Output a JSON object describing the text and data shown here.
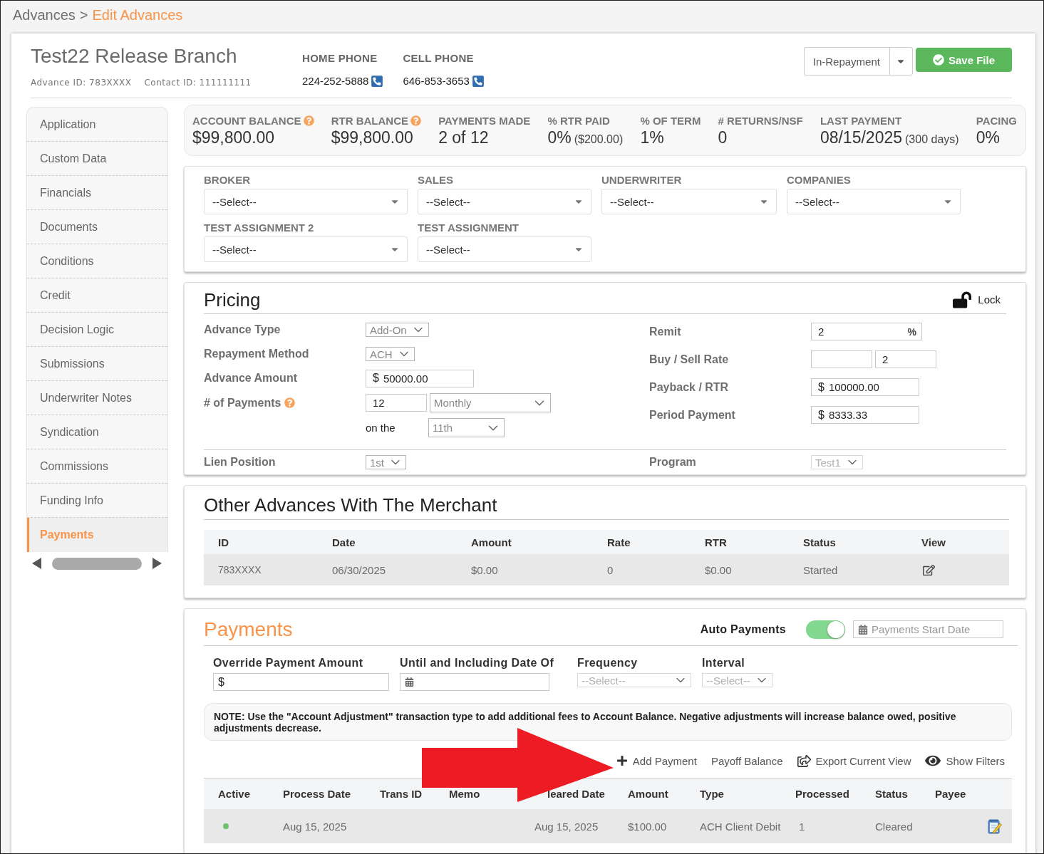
{
  "breadcrumb": {
    "parent": "Advances",
    "separator": ">",
    "current": "Edit Advances"
  },
  "header": {
    "title": "Test22 Release Branch",
    "ids": [
      "Advance ID: 783XXXX",
      "Contact ID: 111111111"
    ],
    "phones": [
      {
        "label": "HOME PHONE",
        "number": "224-252-5888"
      },
      {
        "label": "CELL PHONE",
        "number": "646-853-3653"
      }
    ],
    "status": "In-Repayment",
    "save_label": "Save File"
  },
  "sidebar": {
    "items": [
      {
        "label": "Application",
        "selected": false
      },
      {
        "label": "Custom Data",
        "selected": false
      },
      {
        "label": "Financials",
        "selected": false
      },
      {
        "label": "Documents",
        "selected": false
      },
      {
        "label": "Conditions",
        "selected": false
      },
      {
        "label": "Credit",
        "selected": false
      },
      {
        "label": "Decision Logic",
        "selected": false
      },
      {
        "label": "Submissions",
        "selected": false
      },
      {
        "label": "Underwriter Notes",
        "selected": false
      },
      {
        "label": "Syndication",
        "selected": false
      },
      {
        "label": "Commissions",
        "selected": false
      },
      {
        "label": "Funding Info",
        "selected": false
      },
      {
        "label": "Payments",
        "selected": true
      }
    ]
  },
  "stats": [
    {
      "label": "ACCOUNT BALANCE",
      "help": true,
      "value": "$99,800.00"
    },
    {
      "label": "RTR BALANCE",
      "help": true,
      "value": "$99,800.00"
    },
    {
      "label": "PAYMENTS MADE",
      "value": "2 of 12"
    },
    {
      "label": "% RTR PAID",
      "value": "0%",
      "detail": "($200.00)"
    },
    {
      "label": "% OF TERM",
      "value": "1%"
    },
    {
      "label": "# RETURNS/NSF",
      "value": "0"
    },
    {
      "label": "LAST PAYMENT",
      "value": "08/15/2025",
      "detail": "(300 days)"
    },
    {
      "label": "PACING",
      "value": "0%"
    }
  ],
  "assignments": [
    {
      "label": "BROKER",
      "value": "--Select--"
    },
    {
      "label": "SALES",
      "value": "--Select--"
    },
    {
      "label": "UNDERWRITER",
      "value": "--Select--"
    },
    {
      "label": "COMPANIES",
      "value": "--Select--"
    },
    {
      "label": "TEST ASSIGNMENT 2",
      "value": "--Select--"
    },
    {
      "label": "TEST ASSIGNMENT",
      "value": "--Select--"
    }
  ],
  "pricing": {
    "title": "Pricing",
    "lock": {
      "label": "Lock",
      "locked": false
    },
    "left": [
      {
        "label": "Advance Type",
        "fields": [
          {
            "kind": "select",
            "value": "Add-On",
            "disabled": false
          }
        ]
      },
      {
        "label": "Repayment Method",
        "fields": [
          {
            "kind": "select",
            "value": "ACH",
            "disabled": false
          }
        ]
      },
      {
        "label": "Advance Amount",
        "fields": [
          {
            "kind": "input",
            "prefix": "$",
            "value": "50000.00"
          }
        ]
      },
      {
        "label": "# of Payments",
        "help": true,
        "fields": [
          {
            "kind": "input",
            "value": "12"
          },
          {
            "kind": "select",
            "value": "Monthly",
            "disabled": false
          }
        ]
      },
      {
        "note": "on the",
        "fields": [
          {
            "kind": "select",
            "value": "11th",
            "disabled": false
          }
        ]
      }
    ],
    "right": [
      {
        "label": "Remit",
        "fields": [
          {
            "kind": "input",
            "value": "2",
            "suffix": "%"
          }
        ]
      },
      {
        "label": "Buy / Sell Rate",
        "fields": [
          {
            "kind": "input"
          },
          {
            "kind": "input",
            "value": "2"
          }
        ]
      },
      {
        "label": "Payback / RTR",
        "fields": [
          {
            "kind": "input",
            "prefix": "$",
            "value": "100000.00"
          }
        ]
      },
      {
        "label": "Period Payment",
        "fields": [
          {
            "kind": "input",
            "prefix": "$",
            "value": "8333.33"
          }
        ]
      }
    ],
    "footer": [
      {
        "label": "Lien Position",
        "fields": [
          {
            "kind": "select",
            "value": "1st",
            "disabled": false
          }
        ]
      },
      {
        "label": "Program",
        "fields": [
          {
            "kind": "select",
            "value": "Test1",
            "disabled": true
          }
        ]
      }
    ]
  },
  "other_advances": {
    "title": "Other Advances With The Merchant",
    "columns": [
      "ID",
      "Date",
      "Amount",
      "Rate",
      "RTR",
      "Status",
      "View"
    ],
    "rows": [
      [
        "783XXXX",
        "06/30/2025",
        "$0.00",
        "0",
        "$0.00",
        "Started"
      ]
    ]
  },
  "payments": {
    "title": "Payments",
    "auto_payments": {
      "label": "Auto Payments",
      "on": true
    },
    "start_date": {
      "placeholder": "Payments Start Date"
    },
    "filters": [
      {
        "label": "Override Payment Amount",
        "kind": "money",
        "prefix": "$"
      },
      {
        "label": "Until and Including Date Of",
        "kind": "date"
      },
      {
        "label": "Frequency",
        "kind": "select",
        "value": "--Select--",
        "disabled": true
      },
      {
        "label": "Interval",
        "kind": "select",
        "value": "--Select--",
        "disabled": true
      }
    ],
    "note": "NOTE: Use the \"Account Adjustment\" transaction type to add additional fees to Account Balance. Negative adjustments will increase balance owed, positive adjustments decrease.",
    "actions": [
      {
        "label": "Add Payment",
        "kind": "add"
      },
      {
        "label": "Payoff Balance",
        "kind": "link"
      },
      {
        "label": "Export Current View",
        "kind": "export"
      },
      {
        "label": "Show Filters",
        "kind": "filters"
      }
    ],
    "table": {
      "columns": [
        "Active",
        "Process Date",
        "Trans ID",
        "Memo",
        "leared Date",
        "Amount",
        "Type",
        "Processed",
        "Status",
        "Payee"
      ],
      "rows": [
        {
          "active": true,
          "process_date": "Aug 15, 2025",
          "cleared_date": "Aug 15, 2025",
          "amount": "$100.00",
          "type": "ACH Client Debit",
          "processed": "1",
          "status": "Cleared"
        }
      ]
    }
  }
}
